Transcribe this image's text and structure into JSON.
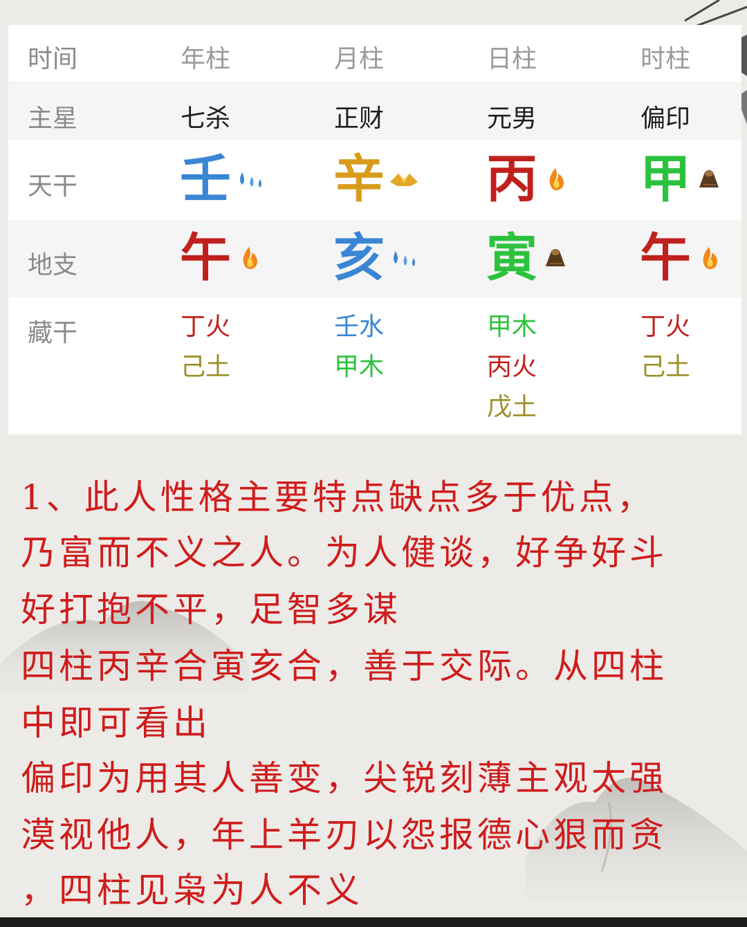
{
  "colors": {
    "fire": "#c0211d",
    "water": "#3a86d4",
    "wood": "#2cc23e",
    "metal": "#d99b1c",
    "earth": "#9a8f26",
    "text_red": "#cf1c1c"
  },
  "table": {
    "header": {
      "label": "时间",
      "cols": [
        "年柱",
        "月柱",
        "日柱",
        "时柱"
      ]
    },
    "main_star": {
      "label": "主星",
      "values": [
        "七杀",
        "正财",
        "元男",
        "偏印"
      ]
    },
    "heavenly_stems": {
      "label": "天干",
      "cells": [
        {
          "char": "壬",
          "element": "water",
          "icon": "water-drops-icon"
        },
        {
          "char": "辛",
          "element": "metal",
          "icon": "gold-ingot-icon"
        },
        {
          "char": "丙",
          "element": "fire",
          "icon": "flame-icon"
        },
        {
          "char": "甲",
          "element": "wood",
          "icon": "log-icon"
        }
      ]
    },
    "earthly_branches": {
      "label": "地支",
      "cells": [
        {
          "char": "午",
          "element": "fire",
          "icon": "flame-icon"
        },
        {
          "char": "亥",
          "element": "water",
          "icon": "water-drops-icon"
        },
        {
          "char": "寅",
          "element": "wood",
          "icon": "log-icon"
        },
        {
          "char": "午",
          "element": "fire",
          "icon": "flame-icon"
        }
      ]
    },
    "hidden_stems": {
      "label": "藏干",
      "cols": [
        [
          {
            "text": "丁火",
            "element": "fire"
          },
          {
            "text": "己土",
            "element": "earth"
          }
        ],
        [
          {
            "text": "壬水",
            "element": "water"
          },
          {
            "text": "甲木",
            "element": "wood"
          }
        ],
        [
          {
            "text": "甲木",
            "element": "wood"
          },
          {
            "text": "丙火",
            "element": "fire"
          },
          {
            "text": "戊土",
            "element": "earth"
          }
        ],
        [
          {
            "text": "丁火",
            "element": "fire"
          },
          {
            "text": "己土",
            "element": "earth"
          }
        ]
      ]
    }
  },
  "paragraph_lines": [
    "1、此人性格主要特点缺点多于优点，",
    "乃富而不义之人。为人健谈，好争好斗",
    "好打抱不平，足智多谋",
    "四柱丙辛合寅亥合，善于交际。从四柱",
    "中即可看出",
    "偏印为用其人善变，尖锐刻薄主观太强",
    "漠视他人，年上羊刃以怨报德心狠而贪",
    "，四柱见枭为人不义"
  ]
}
